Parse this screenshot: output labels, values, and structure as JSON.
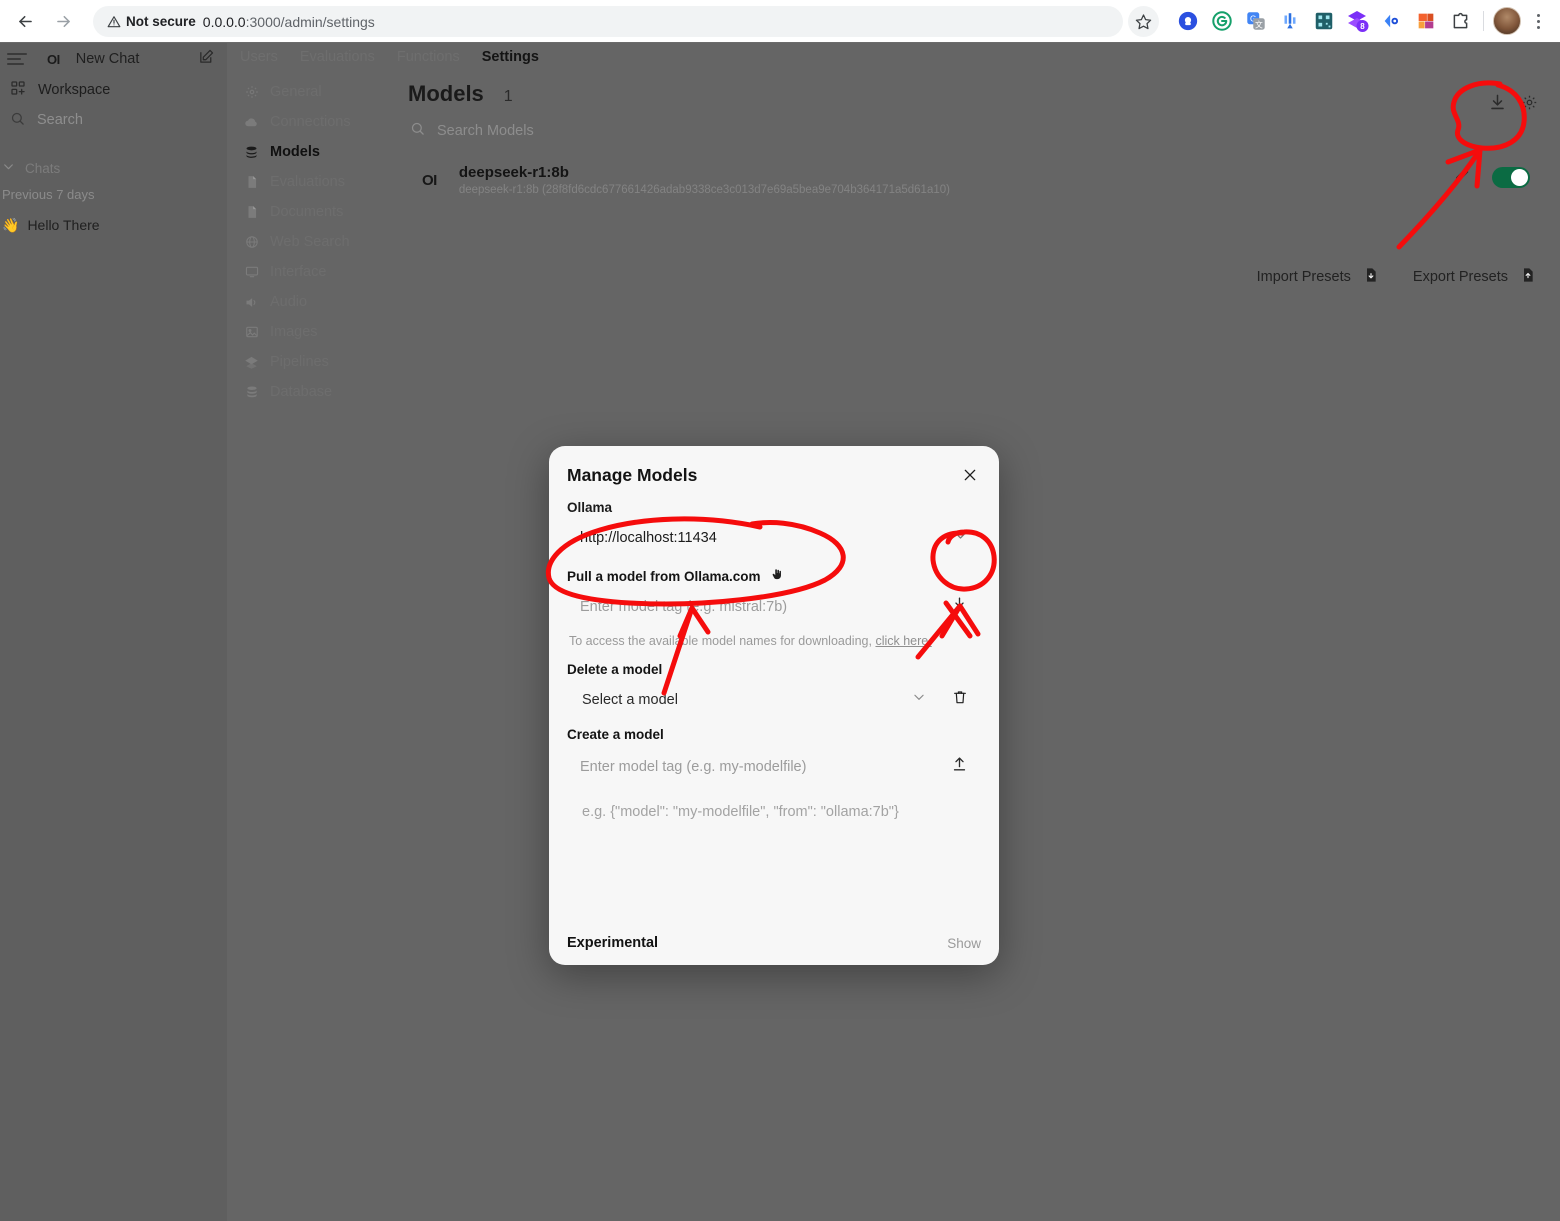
{
  "browser": {
    "security_label": "Not secure",
    "url_host": "0.0.0.0",
    "url_path": ":3000/admin/settings",
    "back_icon": "back-arrow-icon",
    "forward_icon": "forward-arrow-icon",
    "reload_icon": "reload-icon",
    "star_icon": "bookmark-star-icon",
    "extensions": [
      "extension-icon-blue-circle",
      "extension-icon-grammarly",
      "extension-icon-google-translate",
      "extension-icon-chart",
      "extension-icon-qr",
      "extension-icon-purple-badge-8",
      "extension-icon-blue-eye",
      "extension-icon-orange-squares",
      "extension-icon-puzzle"
    ],
    "badge_count": "8",
    "avatar": "profile-avatar",
    "menu_icon": "kebab-menu-icon"
  },
  "sidebar": {
    "menu_icon": "hamburger-icon",
    "logo_text": "OI",
    "new_chat_label": "New Chat",
    "edit_icon": "new-chat-pencil-icon",
    "workspace_label": "Workspace",
    "search_placeholder": "Search",
    "chats_label": "Chats",
    "section_label": "Previous 7 days",
    "chat_items": [
      {
        "emoji": "👋",
        "label": "Hello There"
      }
    ]
  },
  "settings": {
    "tabs": [
      {
        "label": "Users",
        "active": false
      },
      {
        "label": "Evaluations",
        "active": false
      },
      {
        "label": "Functions",
        "active": false
      },
      {
        "label": "Settings",
        "active": true
      }
    ],
    "nav_items": [
      {
        "label": "General",
        "icon": "gear-icon",
        "active": false
      },
      {
        "label": "Connections",
        "icon": "cloud-icon",
        "active": false
      },
      {
        "label": "Models",
        "icon": "stack-icon",
        "active": true
      },
      {
        "label": "Evaluations",
        "icon": "document-icon",
        "active": false
      },
      {
        "label": "Documents",
        "icon": "file-icon",
        "active": false
      },
      {
        "label": "Web Search",
        "icon": "globe-icon",
        "active": false
      },
      {
        "label": "Interface",
        "icon": "monitor-icon",
        "active": false
      },
      {
        "label": "Audio",
        "icon": "speaker-icon",
        "active": false
      },
      {
        "label": "Images",
        "icon": "image-icon",
        "active": false
      },
      {
        "label": "Pipelines",
        "icon": "layers-icon",
        "active": false
      },
      {
        "label": "Database",
        "icon": "database-icon",
        "active": false
      }
    ]
  },
  "models_panel": {
    "title": "Models",
    "count": "1",
    "search_placeholder": "Search Models",
    "search_icon": "search-icon",
    "download_icon": "download-icon",
    "settings_icon": "gear-icon",
    "edit_icon": "pencil-icon",
    "toggle_state": "on",
    "models": [
      {
        "badge": "OI",
        "name": "deepseek-r1:8b",
        "detail": "deepseek-r1:8b (28f8fd6cdc677661426adab9338ce3c013d7e69a5bea9e704b364171a5d61a10)"
      }
    ],
    "import_presets_label": "Import Presets",
    "export_presets_label": "Export Presets",
    "import_icon": "import-file-icon",
    "export_icon": "export-file-icon"
  },
  "modal": {
    "title": "Manage Models",
    "close_icon": "close-icon",
    "ollama_label": "Ollama",
    "ollama_url": "http://localhost:11434",
    "url_chevron_icon": "chevron-down-icon",
    "pull_label": "Pull a model from Ollama.com",
    "pull_emoji_icon": "pinch-hand-icon",
    "pull_placeholder": "Enter model tag (e.g. mistral:7b)",
    "pull_download_icon": "download-icon",
    "hint_text": "To access the available model names for downloading,",
    "hint_link": "click here.",
    "delete_label": "Delete a model",
    "select_placeholder": "Select a model",
    "select_chevron_icon": "chevron-down-icon",
    "delete_icon": "trash-icon",
    "create_label": "Create a model",
    "create_tag_placeholder": "Enter model tag (e.g. my-modelfile)",
    "create_upload_icon": "upload-icon",
    "create_json_placeholder": "e.g. {\"model\": \"my-modelfile\", \"from\": \"ollama:7b\"}",
    "experimental_label": "Experimental",
    "show_label": "Show"
  },
  "annotations": {
    "ink_color": "#f50c0c",
    "marks": [
      "circle-around-pull-input",
      "circle-around-pull-download-icon",
      "arrow-to-pull-input",
      "arrow-to-delete-model-row",
      "circle-around-top-download-icon",
      "arrow-from-presets-to-download-icon"
    ]
  }
}
